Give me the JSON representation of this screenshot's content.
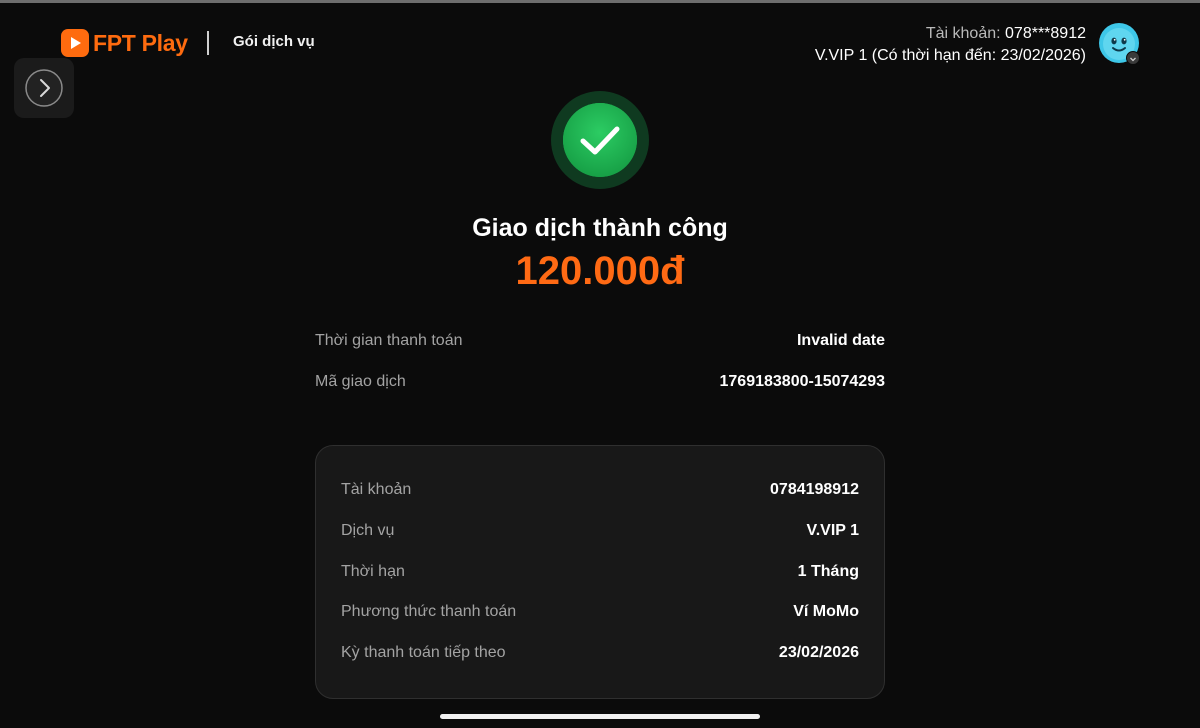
{
  "brand": {
    "name": "FPT Play",
    "accent_color": "#fe6b0f"
  },
  "header": {
    "nav_link": "Gói dịch vụ",
    "account_label": "Tài khoản:",
    "account_value": "078***8912",
    "plan_line": "V.VIP 1 (Có thời hạn đến: 23/02/2026)",
    "avatar_icon": "smiley-avatar-icon"
  },
  "side_toggle": {
    "icon": "chevron-right-icon"
  },
  "result": {
    "icon": "check-circle-icon",
    "success_color": "#1db954",
    "title": "Giao dịch thành công",
    "amount": "120.000đ",
    "amount_color": "#ff6a14"
  },
  "transaction": {
    "rows": [
      {
        "label": "Thời gian thanh toán",
        "value": "Invalid date"
      },
      {
        "label": "Mã giao dịch",
        "value": "1769183800-15074293"
      }
    ]
  },
  "details": {
    "rows": [
      {
        "label": "Tài khoản",
        "value": "0784198912"
      },
      {
        "label": "Dịch vụ",
        "value": "V.VIP 1"
      },
      {
        "label": "Thời hạn",
        "value": "1 Tháng"
      },
      {
        "label": "Phương thức thanh toán",
        "value": "Ví MoMo"
      },
      {
        "label": "Kỳ thanh toán tiếp theo",
        "value": "23/02/2026"
      }
    ]
  }
}
